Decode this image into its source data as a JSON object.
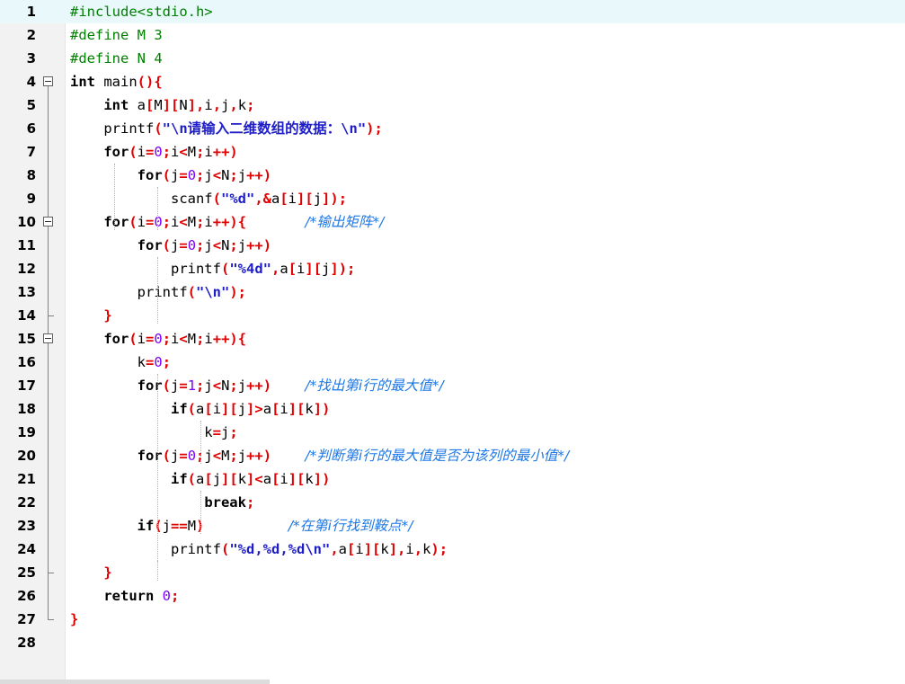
{
  "editor": {
    "current_line": 1,
    "lines": [
      {
        "n": "1",
        "tokens": [
          {
            "t": "#include<stdio.h>",
            "c": "pp"
          }
        ]
      },
      {
        "n": "2",
        "tokens": [
          {
            "t": "#define M 3",
            "c": "pp"
          }
        ]
      },
      {
        "n": "3",
        "tokens": [
          {
            "t": "#define N 4",
            "c": "pp"
          }
        ]
      },
      {
        "n": "4",
        "tokens": [
          {
            "t": "int",
            "c": "kw"
          },
          {
            "t": " main",
            "c": ""
          },
          {
            "t": "(){",
            "c": "op"
          }
        ]
      },
      {
        "n": "5",
        "tokens": [
          {
            "t": "    ",
            "c": ""
          },
          {
            "t": "int",
            "c": "kw"
          },
          {
            "t": " a",
            "c": ""
          },
          {
            "t": "[",
            "c": "op"
          },
          {
            "t": "M",
            "c": ""
          },
          {
            "t": "][",
            "c": "op"
          },
          {
            "t": "N",
            "c": ""
          },
          {
            "t": "],",
            "c": "op"
          },
          {
            "t": "i",
            "c": ""
          },
          {
            "t": ",",
            "c": "op"
          },
          {
            "t": "j",
            "c": ""
          },
          {
            "t": ",",
            "c": "op"
          },
          {
            "t": "k",
            "c": ""
          },
          {
            "t": ";",
            "c": "op"
          }
        ]
      },
      {
        "n": "6",
        "tokens": [
          {
            "t": "    printf",
            "c": ""
          },
          {
            "t": "(",
            "c": "op"
          },
          {
            "t": "\"\\n请输入二维数组的数据：\\n\"",
            "c": "str"
          },
          {
            "t": ");",
            "c": "op"
          }
        ]
      },
      {
        "n": "7",
        "tokens": [
          {
            "t": "    ",
            "c": ""
          },
          {
            "t": "for",
            "c": "kw"
          },
          {
            "t": "(",
            "c": "op"
          },
          {
            "t": "i",
            "c": ""
          },
          {
            "t": "=",
            "c": "op"
          },
          {
            "t": "0",
            "c": "num"
          },
          {
            "t": ";",
            "c": "op"
          },
          {
            "t": "i",
            "c": ""
          },
          {
            "t": "<",
            "c": "op"
          },
          {
            "t": "M",
            "c": ""
          },
          {
            "t": ";",
            "c": "op"
          },
          {
            "t": "i",
            "c": ""
          },
          {
            "t": "++)",
            "c": "op"
          }
        ]
      },
      {
        "n": "8",
        "tokens": [
          {
            "t": "        ",
            "c": ""
          },
          {
            "t": "for",
            "c": "kw"
          },
          {
            "t": "(",
            "c": "op"
          },
          {
            "t": "j",
            "c": ""
          },
          {
            "t": "=",
            "c": "op"
          },
          {
            "t": "0",
            "c": "num"
          },
          {
            "t": ";",
            "c": "op"
          },
          {
            "t": "j",
            "c": ""
          },
          {
            "t": "<",
            "c": "op"
          },
          {
            "t": "N",
            "c": ""
          },
          {
            "t": ";",
            "c": "op"
          },
          {
            "t": "j",
            "c": ""
          },
          {
            "t": "++)",
            "c": "op"
          }
        ]
      },
      {
        "n": "9",
        "tokens": [
          {
            "t": "            scanf",
            "c": ""
          },
          {
            "t": "(",
            "c": "op"
          },
          {
            "t": "\"%d\"",
            "c": "str"
          },
          {
            "t": ",&",
            "c": "op"
          },
          {
            "t": "a",
            "c": ""
          },
          {
            "t": "[",
            "c": "op"
          },
          {
            "t": "i",
            "c": ""
          },
          {
            "t": "][",
            "c": "op"
          },
          {
            "t": "j",
            "c": ""
          },
          {
            "t": "]);",
            "c": "op"
          }
        ]
      },
      {
        "n": "10",
        "tokens": [
          {
            "t": "    ",
            "c": ""
          },
          {
            "t": "for",
            "c": "kw"
          },
          {
            "t": "(",
            "c": "op"
          },
          {
            "t": "i",
            "c": ""
          },
          {
            "t": "=",
            "c": "op"
          },
          {
            "t": "0",
            "c": "num"
          },
          {
            "t": ";",
            "c": "op"
          },
          {
            "t": "i",
            "c": ""
          },
          {
            "t": "<",
            "c": "op"
          },
          {
            "t": "M",
            "c": ""
          },
          {
            "t": ";",
            "c": "op"
          },
          {
            "t": "i",
            "c": ""
          },
          {
            "t": "++){",
            "c": "op"
          },
          {
            "t": "       ",
            "c": ""
          },
          {
            "t": "/*输出矩阵*/",
            "c": "cmt"
          }
        ]
      },
      {
        "n": "11",
        "tokens": [
          {
            "t": "        ",
            "c": ""
          },
          {
            "t": "for",
            "c": "kw"
          },
          {
            "t": "(",
            "c": "op"
          },
          {
            "t": "j",
            "c": ""
          },
          {
            "t": "=",
            "c": "op"
          },
          {
            "t": "0",
            "c": "num"
          },
          {
            "t": ";",
            "c": "op"
          },
          {
            "t": "j",
            "c": ""
          },
          {
            "t": "<",
            "c": "op"
          },
          {
            "t": "N",
            "c": ""
          },
          {
            "t": ";",
            "c": "op"
          },
          {
            "t": "j",
            "c": ""
          },
          {
            "t": "++)",
            "c": "op"
          }
        ]
      },
      {
        "n": "12",
        "tokens": [
          {
            "t": "            printf",
            "c": ""
          },
          {
            "t": "(",
            "c": "op"
          },
          {
            "t": "\"%4d\"",
            "c": "str"
          },
          {
            "t": ",",
            "c": "op"
          },
          {
            "t": "a",
            "c": ""
          },
          {
            "t": "[",
            "c": "op"
          },
          {
            "t": "i",
            "c": ""
          },
          {
            "t": "][",
            "c": "op"
          },
          {
            "t": "j",
            "c": ""
          },
          {
            "t": "]);",
            "c": "op"
          }
        ]
      },
      {
        "n": "13",
        "tokens": [
          {
            "t": "        printf",
            "c": ""
          },
          {
            "t": "(",
            "c": "op"
          },
          {
            "t": "\"\\n\"",
            "c": "str"
          },
          {
            "t": ");",
            "c": "op"
          }
        ]
      },
      {
        "n": "14",
        "tokens": [
          {
            "t": "    ",
            "c": ""
          },
          {
            "t": "}",
            "c": "op"
          }
        ]
      },
      {
        "n": "15",
        "tokens": [
          {
            "t": "    ",
            "c": ""
          },
          {
            "t": "for",
            "c": "kw"
          },
          {
            "t": "(",
            "c": "op"
          },
          {
            "t": "i",
            "c": ""
          },
          {
            "t": "=",
            "c": "op"
          },
          {
            "t": "0",
            "c": "num"
          },
          {
            "t": ";",
            "c": "op"
          },
          {
            "t": "i",
            "c": ""
          },
          {
            "t": "<",
            "c": "op"
          },
          {
            "t": "M",
            "c": ""
          },
          {
            "t": ";",
            "c": "op"
          },
          {
            "t": "i",
            "c": ""
          },
          {
            "t": "++){",
            "c": "op"
          }
        ]
      },
      {
        "n": "16",
        "tokens": [
          {
            "t": "        k",
            "c": ""
          },
          {
            "t": "=",
            "c": "op"
          },
          {
            "t": "0",
            "c": "num"
          },
          {
            "t": ";",
            "c": "op"
          }
        ]
      },
      {
        "n": "17",
        "tokens": [
          {
            "t": "        ",
            "c": ""
          },
          {
            "t": "for",
            "c": "kw"
          },
          {
            "t": "(",
            "c": "op"
          },
          {
            "t": "j",
            "c": ""
          },
          {
            "t": "=",
            "c": "op"
          },
          {
            "t": "1",
            "c": "num"
          },
          {
            "t": ";",
            "c": "op"
          },
          {
            "t": "j",
            "c": ""
          },
          {
            "t": "<",
            "c": "op"
          },
          {
            "t": "N",
            "c": ""
          },
          {
            "t": ";",
            "c": "op"
          },
          {
            "t": "j",
            "c": ""
          },
          {
            "t": "++)",
            "c": "op"
          },
          {
            "t": "    ",
            "c": ""
          },
          {
            "t": "/*找出第i行的最大值*/",
            "c": "cmt"
          }
        ]
      },
      {
        "n": "18",
        "tokens": [
          {
            "t": "            ",
            "c": ""
          },
          {
            "t": "if",
            "c": "kw"
          },
          {
            "t": "(",
            "c": "op"
          },
          {
            "t": "a",
            "c": ""
          },
          {
            "t": "[",
            "c": "op"
          },
          {
            "t": "i",
            "c": ""
          },
          {
            "t": "][",
            "c": "op"
          },
          {
            "t": "j",
            "c": ""
          },
          {
            "t": "]>",
            "c": "op"
          },
          {
            "t": "a",
            "c": ""
          },
          {
            "t": "[",
            "c": "op"
          },
          {
            "t": "i",
            "c": ""
          },
          {
            "t": "][",
            "c": "op"
          },
          {
            "t": "k",
            "c": ""
          },
          {
            "t": "])",
            "c": "op"
          }
        ]
      },
      {
        "n": "19",
        "tokens": [
          {
            "t": "                k",
            "c": ""
          },
          {
            "t": "=",
            "c": "op"
          },
          {
            "t": "j",
            "c": ""
          },
          {
            "t": ";",
            "c": "op"
          }
        ]
      },
      {
        "n": "20",
        "tokens": [
          {
            "t": "        ",
            "c": ""
          },
          {
            "t": "for",
            "c": "kw"
          },
          {
            "t": "(",
            "c": "op"
          },
          {
            "t": "j",
            "c": ""
          },
          {
            "t": "=",
            "c": "op"
          },
          {
            "t": "0",
            "c": "num"
          },
          {
            "t": ";",
            "c": "op"
          },
          {
            "t": "j",
            "c": ""
          },
          {
            "t": "<",
            "c": "op"
          },
          {
            "t": "M",
            "c": ""
          },
          {
            "t": ";",
            "c": "op"
          },
          {
            "t": "j",
            "c": ""
          },
          {
            "t": "++)",
            "c": "op"
          },
          {
            "t": "    ",
            "c": ""
          },
          {
            "t": "/*判断第i行的最大值是否为该列的最小值*/",
            "c": "cmt"
          }
        ]
      },
      {
        "n": "21",
        "tokens": [
          {
            "t": "            ",
            "c": ""
          },
          {
            "t": "if",
            "c": "kw"
          },
          {
            "t": "(",
            "c": "op"
          },
          {
            "t": "a",
            "c": ""
          },
          {
            "t": "[",
            "c": "op"
          },
          {
            "t": "j",
            "c": ""
          },
          {
            "t": "][",
            "c": "op"
          },
          {
            "t": "k",
            "c": ""
          },
          {
            "t": "]<",
            "c": "op"
          },
          {
            "t": "a",
            "c": ""
          },
          {
            "t": "[",
            "c": "op"
          },
          {
            "t": "i",
            "c": ""
          },
          {
            "t": "][",
            "c": "op"
          },
          {
            "t": "k",
            "c": ""
          },
          {
            "t": "])",
            "c": "op"
          }
        ]
      },
      {
        "n": "22",
        "tokens": [
          {
            "t": "                ",
            "c": ""
          },
          {
            "t": "break",
            "c": "kw"
          },
          {
            "t": ";",
            "c": "op"
          }
        ]
      },
      {
        "n": "23",
        "tokens": [
          {
            "t": "        ",
            "c": ""
          },
          {
            "t": "if",
            "c": "kw"
          },
          {
            "t": "(",
            "c": "op"
          },
          {
            "t": "j",
            "c": ""
          },
          {
            "t": "==",
            "c": "op"
          },
          {
            "t": "M",
            "c": ""
          },
          {
            "t": ")",
            "c": "op"
          },
          {
            "t": "          ",
            "c": ""
          },
          {
            "t": "/*在第i行找到鞍点*/",
            "c": "cmt"
          }
        ]
      },
      {
        "n": "24",
        "tokens": [
          {
            "t": "            printf",
            "c": ""
          },
          {
            "t": "(",
            "c": "op"
          },
          {
            "t": "\"%d,%d,%d\\n\"",
            "c": "str"
          },
          {
            "t": ",",
            "c": "op"
          },
          {
            "t": "a",
            "c": ""
          },
          {
            "t": "[",
            "c": "op"
          },
          {
            "t": "i",
            "c": ""
          },
          {
            "t": "][",
            "c": "op"
          },
          {
            "t": "k",
            "c": ""
          },
          {
            "t": "],",
            "c": "op"
          },
          {
            "t": "i",
            "c": ""
          },
          {
            "t": ",",
            "c": "op"
          },
          {
            "t": "k",
            "c": ""
          },
          {
            "t": ");",
            "c": "op"
          }
        ]
      },
      {
        "n": "25",
        "tokens": [
          {
            "t": "    ",
            "c": ""
          },
          {
            "t": "}",
            "c": "op"
          }
        ]
      },
      {
        "n": "26",
        "tokens": [
          {
            "t": "    ",
            "c": ""
          },
          {
            "t": "return",
            "c": "kw"
          },
          {
            "t": " ",
            "c": ""
          },
          {
            "t": "0",
            "c": "num"
          },
          {
            "t": ";",
            "c": "op"
          }
        ]
      },
      {
        "n": "27",
        "tokens": [
          {
            "t": "}",
            "c": "op"
          }
        ]
      },
      {
        "n": "28",
        "tokens": []
      }
    ],
    "fold_markers": [
      {
        "line": 4,
        "end": 27
      },
      {
        "line": 10,
        "end": 14
      },
      {
        "line": 15,
        "end": 25
      }
    ]
  },
  "colors": {
    "preprocessor": "#008000",
    "operator": "#e00000",
    "number": "#8000ff",
    "string": "#1e1ec8",
    "comment": "#1e78e6",
    "current_line": "#e8f8fb",
    "gutter": "#f2f2f2"
  }
}
